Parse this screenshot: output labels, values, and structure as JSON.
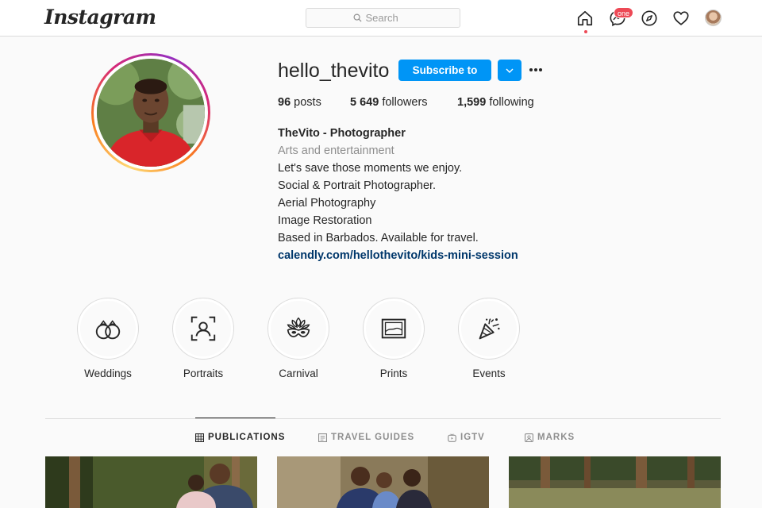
{
  "topbar": {
    "logo": "Instagram",
    "search_placeholder": "Search",
    "messages_badge": "one",
    "icons": [
      "home-icon",
      "messenger-icon",
      "explore-icon",
      "activity-heart-icon",
      "profile-avatar"
    ]
  },
  "profile": {
    "username": "hello_thevito",
    "subscribe_label": "Subscribe to",
    "stats": {
      "posts_count": "96",
      "posts_label": "posts",
      "followers_count": "5 649",
      "followers_label": "followers",
      "following_count": "1,599",
      "following_label": "following"
    },
    "bio": {
      "name": "TheVito - Photographer",
      "category": "Arts and entertainment",
      "lines": [
        "Let's save those moments we enjoy.",
        "Social & Portrait Photographer.",
        "Aerial Photography",
        "Image Restoration",
        "Based in Barbados. Available for travel."
      ],
      "link": "calendly.com/hellothevito/kids-mini-session"
    }
  },
  "highlights": [
    {
      "label": "Weddings",
      "icon": "rings-icon"
    },
    {
      "label": "Portraits",
      "icon": "portrait-focus-icon"
    },
    {
      "label": "Carnival",
      "icon": "carnival-mask-icon"
    },
    {
      "label": "Prints",
      "icon": "framed-print-icon"
    },
    {
      "label": "Events",
      "icon": "party-popper-icon"
    }
  ],
  "tabs": [
    {
      "label": "PUBLICATIONS",
      "icon": "grid-icon",
      "active": true
    },
    {
      "label": "TRAVEL GUIDES",
      "icon": "guide-icon",
      "active": false
    },
    {
      "label": "IGTV",
      "icon": "igtv-icon",
      "active": false
    },
    {
      "label": "MARKS",
      "icon": "tagged-icon",
      "active": false
    }
  ],
  "colors": {
    "primary_button": "#0095f6",
    "link": "#00376b",
    "badge": "#ed4956",
    "muted_text": "#8e8e8e"
  }
}
